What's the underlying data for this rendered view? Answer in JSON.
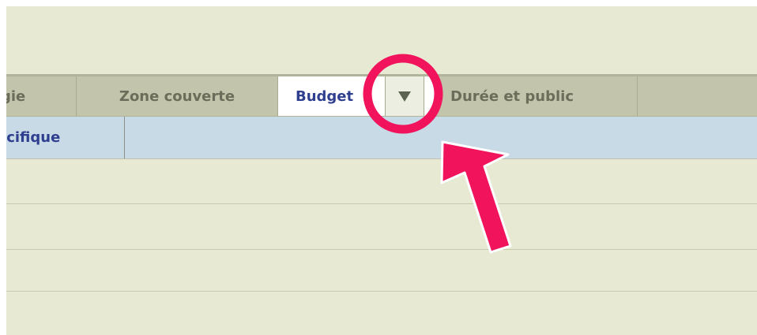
{
  "tabs": [
    {
      "id": "strategy",
      "label": "gie"
    },
    {
      "id": "zone",
      "label": "Zone couverte"
    },
    {
      "id": "budget",
      "label": "Budget",
      "active": true
    },
    {
      "id": "duree",
      "label": "Durée et public"
    }
  ],
  "dropdown": {
    "icon": "caret-down-icon"
  },
  "subtab": {
    "label": "écifique"
  },
  "annotation": {
    "icons": [
      "highlight-circle",
      "pointer-arrow"
    ],
    "color": "#f2135d"
  },
  "colors": {
    "background": "#e7e9d3",
    "tab_bar": "#c2c4ab",
    "active_tab": "#ffffff",
    "active_text": "#2f3f8f",
    "inactive_text": "#6b6d5a",
    "subrow": "#c9dae7"
  }
}
